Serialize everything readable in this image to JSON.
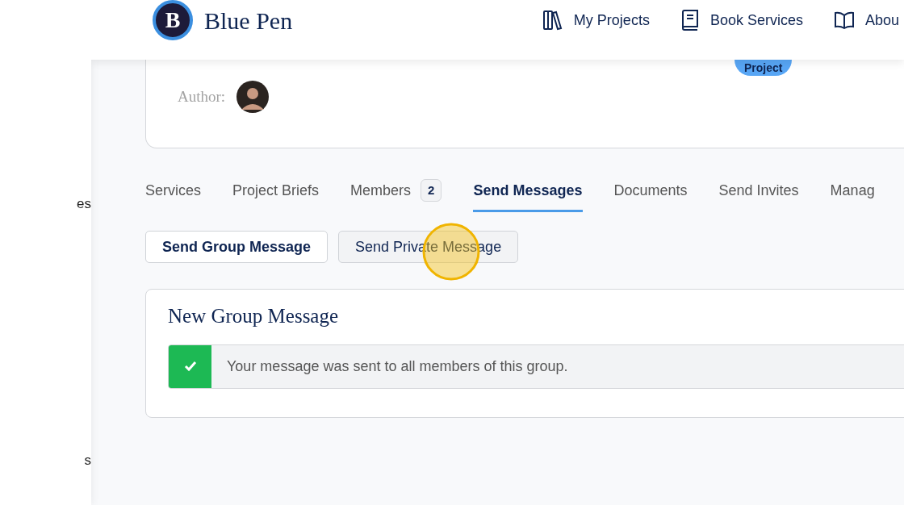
{
  "sidebar": {
    "items": [
      {
        "label": "es"
      },
      {
        "label": "s"
      }
    ]
  },
  "header": {
    "logo_letter": "B",
    "brand": "Blue Pen",
    "nav": [
      {
        "label": "My Projects",
        "kind": "shelf"
      },
      {
        "label": "Book Services",
        "kind": "book"
      },
      {
        "label": "Abou",
        "kind": "open"
      }
    ]
  },
  "project_card": {
    "badge": "Project",
    "author_label": "Author:"
  },
  "tabs": [
    {
      "label": "Services",
      "selected": false
    },
    {
      "label": "Project Briefs",
      "selected": false
    },
    {
      "label": "Members",
      "count": "2",
      "selected": false
    },
    {
      "label": "Send Messages",
      "selected": true
    },
    {
      "label": "Documents",
      "selected": false
    },
    {
      "label": "Send Invites",
      "selected": false
    },
    {
      "label": "Manag",
      "selected": false
    }
  ],
  "message_buttons": [
    {
      "label": "Send Group Message",
      "selected": true
    },
    {
      "label": "Send Private Message",
      "selected": false
    }
  ],
  "message_panel": {
    "title": "New Group Message",
    "alert": {
      "kind": "success",
      "text": "Your message was sent to all members of this group."
    }
  }
}
